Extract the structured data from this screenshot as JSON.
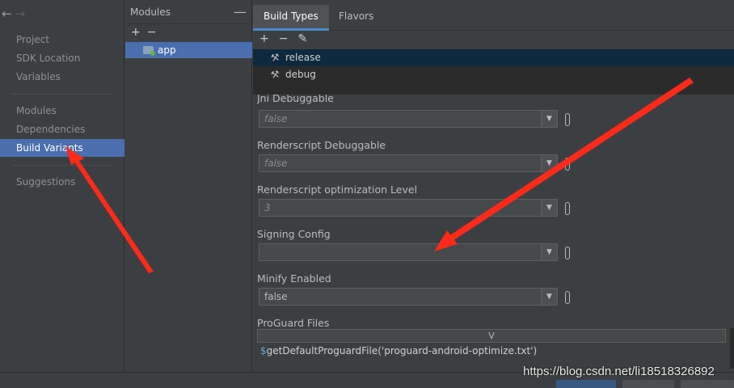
{
  "nav": {
    "back": "←",
    "forward": "→",
    "items": [
      "Project",
      "SDK Location",
      "Variables",
      "Modules",
      "Dependencies",
      "Build Variants",
      "Suggestions"
    ]
  },
  "modules": {
    "title": "Modules",
    "collapse": "—",
    "add": "+",
    "remove": "−",
    "items": [
      "app"
    ]
  },
  "tabs": [
    "Build Types",
    "Flavors"
  ],
  "build_types": {
    "add": "+",
    "remove": "−",
    "edit": "✎",
    "items": [
      "release",
      "debug"
    ]
  },
  "fields": [
    {
      "label": "Jni Debuggable",
      "value": "false"
    },
    {
      "label": "Renderscript Debuggable",
      "value": "false"
    },
    {
      "label": "Renderscript optimization Level",
      "value": "3"
    },
    {
      "label": "Signing Config",
      "value": ""
    },
    {
      "label": "Minify Enabled",
      "value": "false"
    },
    {
      "label": "ProGuard Files",
      "value": ""
    }
  ],
  "proguard": {
    "column": "V",
    "dollar": "$",
    "row": "getDefaultProguardFile('proguard-android-optimize.txt')"
  },
  "dropdown_arrow": "▼",
  "watermark": "https://blog.csdn.net/li18518326892",
  "colors": {
    "selection": "#4b6eaf",
    "tab_underline": "#4a88c7",
    "annotation": "#ff2a1a"
  }
}
